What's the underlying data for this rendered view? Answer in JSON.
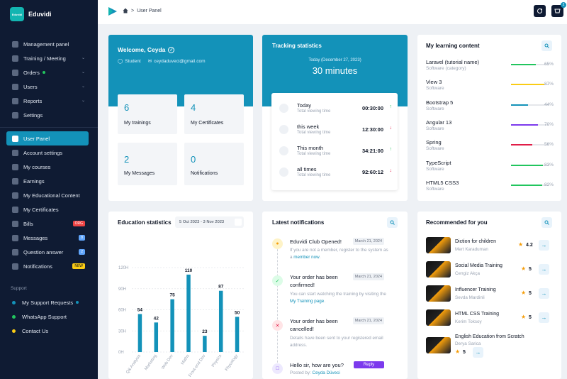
{
  "brand": {
    "name": "Eduvidi",
    "logo_text": "Eduvidi"
  },
  "sidebar": {
    "items": [
      {
        "label": "Management panel",
        "icon": "home-icon"
      },
      {
        "label": "Training / Meeting",
        "icon": "layers-icon",
        "chevron": true
      },
      {
        "label": "Orders",
        "icon": "cart-icon",
        "chevron": true,
        "dot": true
      },
      {
        "label": "Users",
        "icon": "users-icon",
        "chevron": true
      },
      {
        "label": "Reports",
        "icon": "chart-icon",
        "chevron": true
      },
      {
        "label": "Settings",
        "icon": "gear-icon"
      }
    ],
    "user_items": [
      {
        "label": "User Panel",
        "icon": "home-icon",
        "active": true
      },
      {
        "label": "Account settings",
        "icon": "user-cog-icon"
      },
      {
        "label": "My courses",
        "icon": "book-icon"
      },
      {
        "label": "Earnings",
        "icon": "wallet-icon"
      },
      {
        "label": "My Educational Content",
        "icon": "folder-icon"
      },
      {
        "label": "My Certificates",
        "icon": "certificate-icon"
      },
      {
        "label": "Bills",
        "icon": "bill-icon",
        "badge": "ORG",
        "badge_color": "red"
      },
      {
        "label": "Messages",
        "icon": "message-icon",
        "badge": "8",
        "badge_color": "blue"
      },
      {
        "label": "Question answer",
        "icon": "question-icon",
        "badge": "2",
        "badge_color": "blue"
      },
      {
        "label": "Notifications",
        "icon": "bell-icon",
        "badge": "NEW",
        "badge_color": "yellow"
      }
    ],
    "support_label": "Support",
    "support_items": [
      {
        "label": "My Support Requests",
        "color": "#1392b9",
        "dot": true
      },
      {
        "label": "WhatsApp Support",
        "color": "#22c55e"
      },
      {
        "label": "Contact Us",
        "color": "#facc15"
      }
    ]
  },
  "topbar": {
    "breadcrumb": "User Panel",
    "cart_count": "2"
  },
  "welcome": {
    "title": "Welcome, Ceyda",
    "role": "Student",
    "email": "ceydaduveci@gmail.com"
  },
  "stats": [
    {
      "value": "6",
      "label": "My trainings"
    },
    {
      "value": "4",
      "label": "My Certificates"
    },
    {
      "value": "2",
      "label": "My Messages"
    },
    {
      "value": "0",
      "label": "Notifications"
    }
  ],
  "tracking": {
    "title": "Tracking statistics",
    "date": "Today (December 27, 2023)",
    "total": "30 minutes",
    "rows": [
      {
        "title": "Today",
        "sub": "Total viewing time",
        "value": "00:30:00",
        "trend": "up"
      },
      {
        "title": "this week",
        "sub": "Total viewing time",
        "value": "12:30:00",
        "trend": "down"
      },
      {
        "title": "This month",
        "sub": "Total viewing time",
        "value": "34:21:00",
        "trend": "up"
      },
      {
        "title": "all times",
        "sub": "Total viewing time",
        "value": "92:60:12",
        "trend": "down"
      }
    ]
  },
  "learning": {
    "title": "My learning content",
    "items": [
      {
        "name": "Laravel (tutorial name)",
        "sub": "Software (category)",
        "pct": "65%",
        "value": 65,
        "color": "#22c55e"
      },
      {
        "name": "View 3",
        "sub": "Software",
        "pct": "87%",
        "value": 87,
        "color": "#facc15"
      },
      {
        "name": "Bootstrap 5",
        "sub": "Software",
        "pct": "44%",
        "value": 44,
        "color": "#1392b9"
      },
      {
        "name": "Angular 13",
        "sub": "Software",
        "pct": "70%",
        "value": 70,
        "color": "#7c3aed"
      },
      {
        "name": "Spring",
        "sub": "Software",
        "pct": "56%",
        "value": 56,
        "color": "#e11d48"
      },
      {
        "name": "TypeScript",
        "sub": "Software",
        "pct": "83%",
        "value": 83,
        "color": "#22c55e"
      },
      {
        "name": "HTML5 CSS3",
        "sub": "Software",
        "pct": "82%",
        "value": 82,
        "color": "#22c55e"
      }
    ]
  },
  "education": {
    "title": "Education statistics",
    "date_range": "5 Oct 2023 - 3 Nov 2023"
  },
  "chart_data": {
    "type": "bar",
    "categories": [
      "Q& Analysis",
      "Marketing",
      "Web Dev",
      "Maths",
      "Front-end Dev",
      "Physics",
      "Phycology"
    ],
    "values": [
      54,
      42,
      75,
      110,
      23,
      87,
      50
    ],
    "ylim": [
      0,
      120
    ],
    "yticks": [
      "0H",
      "30H",
      "60H",
      "90H",
      "120H"
    ],
    "color": "#1392b9",
    "grid": true
  },
  "notifications": {
    "title": "Latest notifications",
    "items": [
      {
        "title": "Eduvidi Club Opened!",
        "date": "March 21, 2024",
        "desc": "If you are not a member, register to the system as a",
        "link": "member now",
        "desc_end": ".",
        "icon": "bell-icon",
        "color": "#f59e0b",
        "bg": "#fef3c7"
      },
      {
        "title": "Your order has been confirmed!",
        "date": "March 21, 2024",
        "desc": "You can start watching the training by visiting the",
        "link": "My Training page",
        "desc_end": ".",
        "icon": "check-icon",
        "color": "#22c55e",
        "bg": "#dcfce7"
      },
      {
        "title": "Your order has been cancelled!",
        "date": "March 21, 2024",
        "desc": "Details have been sent to your registered email address.",
        "icon": "x-icon",
        "color": "#e11d48",
        "bg": "#ffe4e6"
      },
      {
        "title": "Hello sir, how are you?",
        "reply": "Reply",
        "posted_by": "Posted by:",
        "author": "Ceyda Düveci",
        "icon": "message-icon",
        "color": "#7c3aed",
        "bg": "#ede9fe"
      }
    ]
  },
  "recommended": {
    "title": "Recommended for you",
    "items": [
      {
        "title": "Diction for children",
        "author": "Mert Karaduman",
        "rating": "4.2"
      },
      {
        "title": "Social Media Training",
        "author": "Cengiz Akça",
        "rating": "5"
      },
      {
        "title": "Influencer Training",
        "author": "Sevda Mardinli",
        "rating": "5"
      },
      {
        "title": "HTML CSS Training",
        "author": "Kerim Toksoy",
        "rating": "5"
      },
      {
        "title": "English Education from Scratch",
        "author": "Derya Sarica",
        "rating": "5"
      }
    ]
  }
}
